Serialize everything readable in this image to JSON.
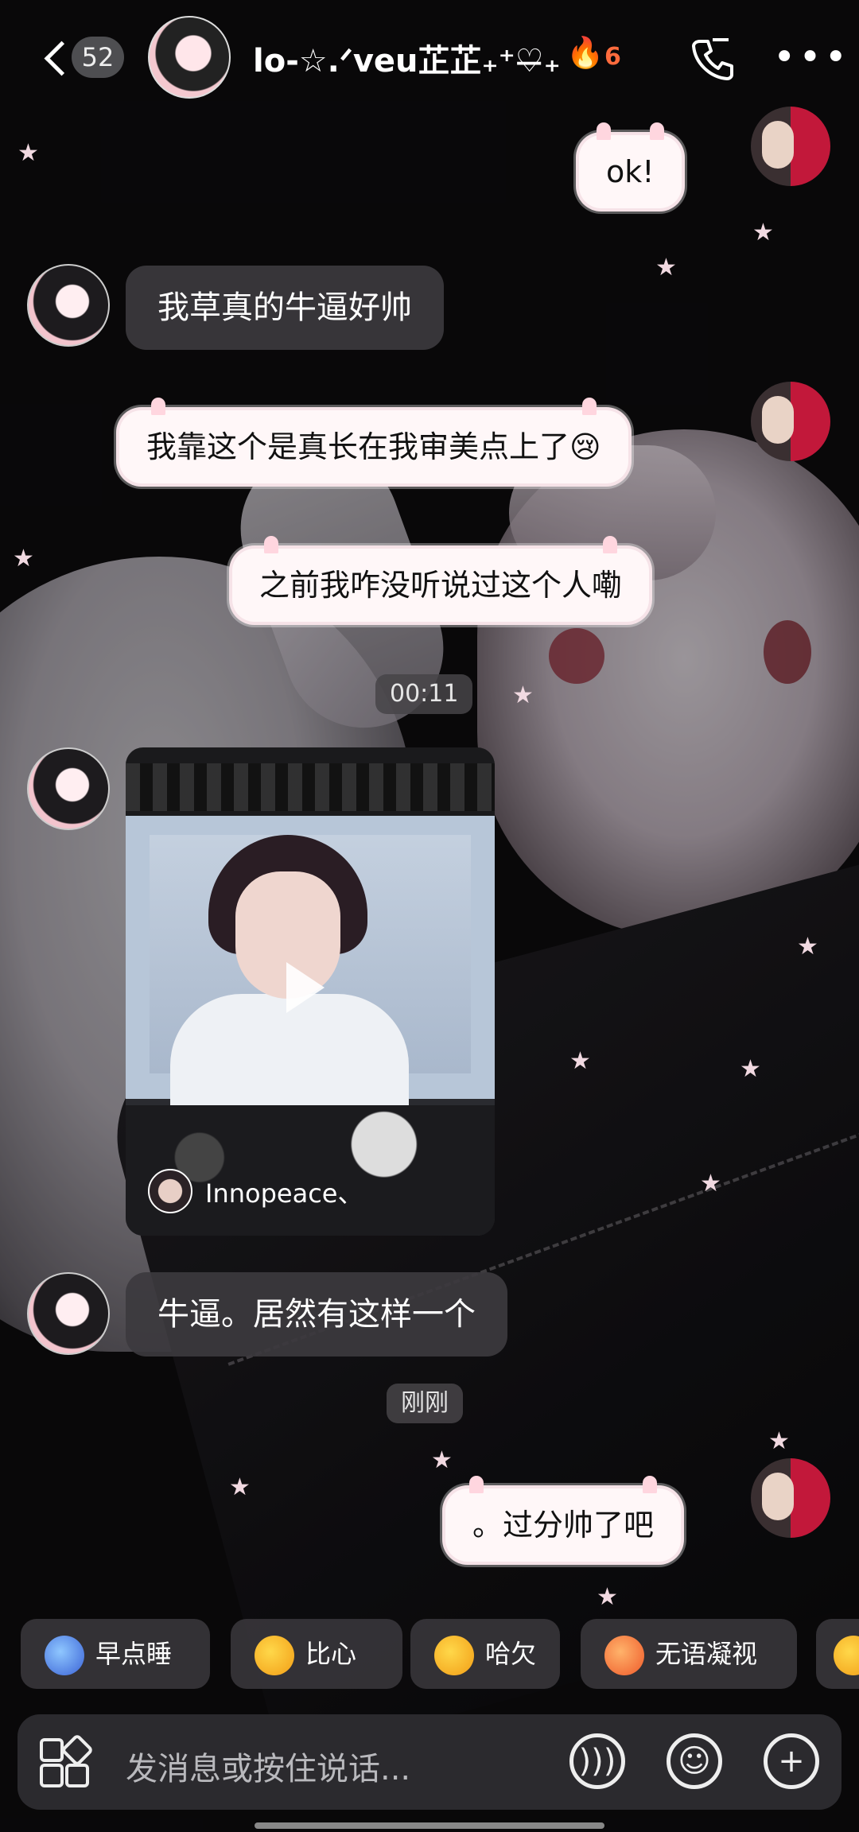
{
  "header": {
    "unread_count": "52",
    "title": "lo-☆.ᐟveu芷芷₊⁺♡̶₊",
    "streak": "6",
    "icons": {
      "back": "back-arrow-icon",
      "call": "phone-call-icon",
      "more": "more-dots-icon",
      "streak": "flame-icon"
    }
  },
  "messages": [
    {
      "side": "me",
      "text": "ok!"
    },
    {
      "side": "them",
      "text": "我草真的牛逼好帅"
    },
    {
      "side": "me",
      "text": "我靠这个是真长在我审美点上了😢"
    },
    {
      "side": "me",
      "text": "之前我咋没听说过这个人嘞"
    },
    {
      "side": "time",
      "text": "00:11"
    },
    {
      "side": "them",
      "type": "video",
      "author": "Innopeace、"
    },
    {
      "side": "them",
      "text": "牛逼。居然有这样一个"
    },
    {
      "side": "time",
      "text": "刚刚"
    },
    {
      "side": "me",
      "text": "。过分帅了吧"
    }
  ],
  "quick_replies": [
    "早点睡",
    "比心",
    "哈欠",
    "无语凝视"
  ],
  "input": {
    "placeholder": "发消息或按住说话...",
    "icons": {
      "apps": "apps-grid-icon",
      "voice": "voice-icon",
      "emoji": "emoji-icon",
      "plus": "plus-icon"
    }
  },
  "colors": {
    "bubble_me": "#fff7f8",
    "bubble_them": "#3c3a3e",
    "accent": "#ff5a1f"
  }
}
